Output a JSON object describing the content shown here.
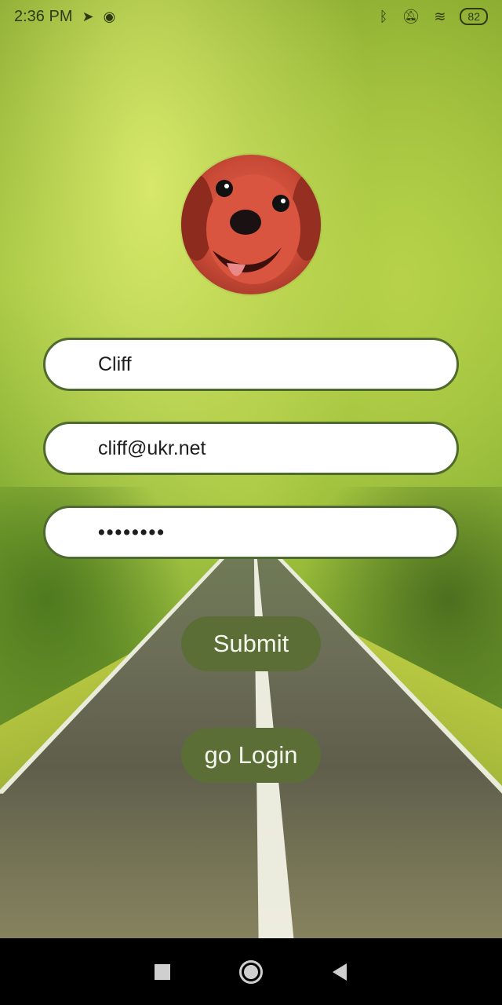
{
  "status_bar": {
    "time": "2:36 PM",
    "battery": "82",
    "icons": [
      "telegram-icon",
      "app-icon",
      "bluetooth-icon",
      "silent-icon",
      "wifi-icon",
      "battery-icon"
    ]
  },
  "avatar": {
    "icon": "dog-avatar"
  },
  "form": {
    "name_value": "Cliff",
    "email_value": "cliff@ukr.net",
    "password_value": "••••••••"
  },
  "buttons": {
    "submit_label": "Submit",
    "login_label": "go Login"
  },
  "colors": {
    "button_bg": "#5a6e36",
    "input_border": "#4f6a2e",
    "input_bg": "#ffffff"
  },
  "nav_bar": {
    "icons": [
      "recent-apps-icon",
      "home-icon",
      "back-icon"
    ]
  }
}
